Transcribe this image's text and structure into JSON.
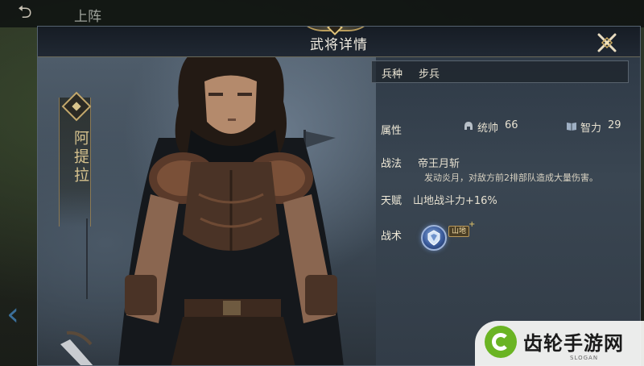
{
  "top_bar": {
    "back_glyph": "⮌",
    "title": "上阵"
  },
  "modal": {
    "title": "武将详情",
    "close_icon": "close-x-icon"
  },
  "hero": {
    "name": "阿提拉"
  },
  "details": {
    "troop_type_label": "兵种",
    "troop_type_value": "步兵",
    "attributes_label": "属性",
    "command_label": "统帅",
    "command_value": "66",
    "intellect_label": "智力",
    "intellect_value": "29",
    "tactic_label": "战法",
    "tactic_name": "帝王月斩",
    "tactic_desc": "发动炎月，对敌方前2排部队造成大量伤害。",
    "talent_label": "天赋",
    "talent_value": "山地战斗力+16%",
    "skill_label": "战术",
    "skill_badge": "山地",
    "skill_plus": "+"
  },
  "watermark": {
    "text": "齿轮手游网",
    "slogan": "SLOGAN"
  },
  "colors": {
    "accent_gold": "#c3a86c",
    "panel_bg": "#3a4652",
    "watermark_green": "#6ab423"
  }
}
